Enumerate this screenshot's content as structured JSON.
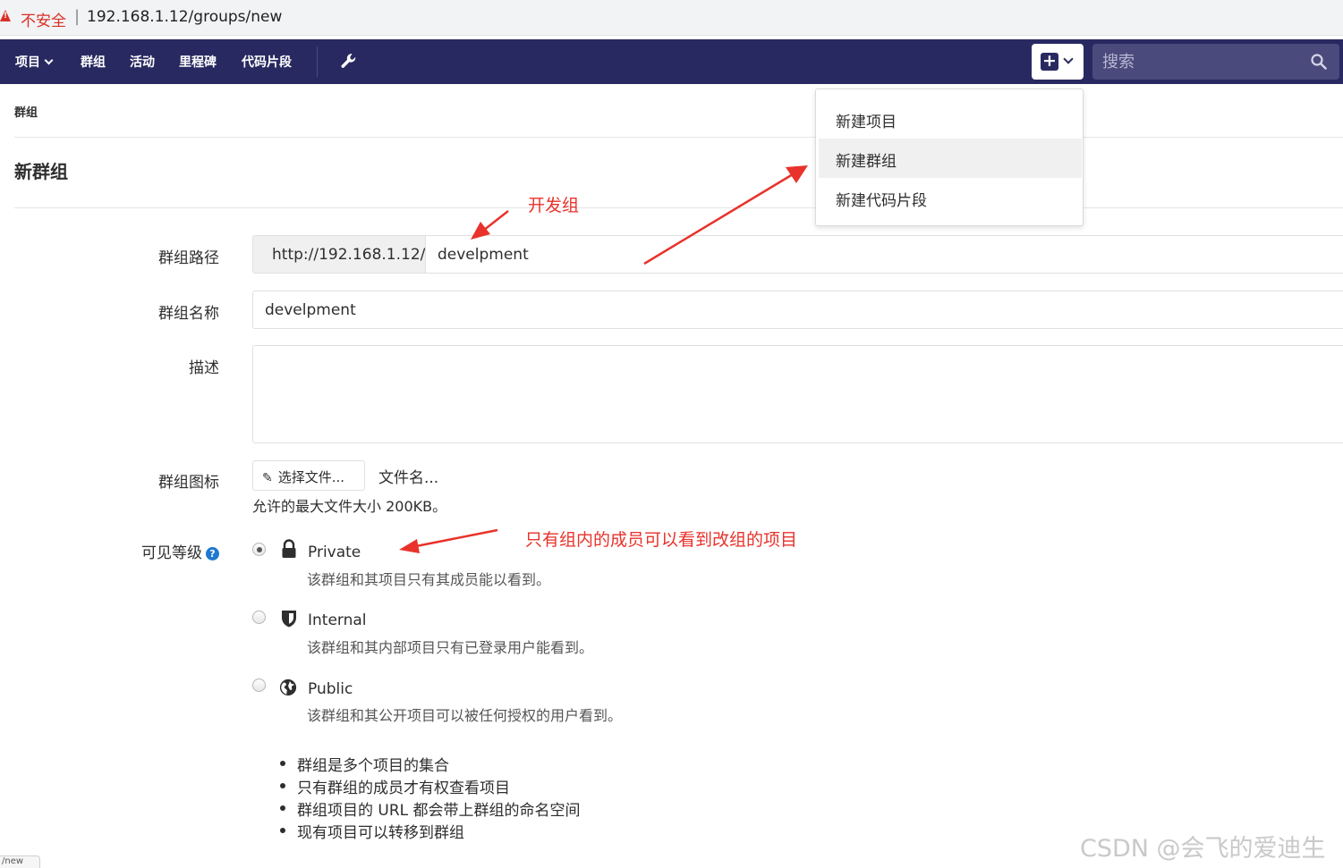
{
  "browser": {
    "insecure_label": "不安全",
    "separator": "|",
    "url": "192.168.1.12/groups/new"
  },
  "nav": {
    "items": [
      {
        "label": "项目"
      },
      {
        "label": "群组"
      },
      {
        "label": "活动"
      },
      {
        "label": "里程碑"
      },
      {
        "label": "代码片段"
      }
    ],
    "search_placeholder": "搜索",
    "color": "#292961"
  },
  "dropdown": {
    "items": [
      {
        "label": "新建项目"
      },
      {
        "label": "新建群组"
      },
      {
        "label": "新建代码片段"
      }
    ],
    "active_index": 1
  },
  "breadcrumb": "群组",
  "page_title": "新群组",
  "form": {
    "path_label": "群组路径",
    "path_prefix": "http://192.168.1.12/",
    "path_value": "develpment",
    "name_label": "群组名称",
    "name_value": "develpment",
    "desc_label": "描述",
    "desc_value": "",
    "icon_label": "群组图标",
    "file_button": "选择文件...",
    "file_name": "文件名...",
    "file_help": "允许的最大文件大小 200KB。",
    "visibility_label": "可见等级",
    "visibility": [
      {
        "title": "Private",
        "desc": "该群组和其项目只有其成员能以看到。",
        "checked": true,
        "icon": "lock-icon"
      },
      {
        "title": "Internal",
        "desc": "该群组和其内部项目只有已登录用户能看到。",
        "checked": false,
        "icon": "shield-icon"
      },
      {
        "title": "Public",
        "desc": "该群组和其公开项目可以被任何授权的用户看到。",
        "checked": false,
        "icon": "globe-icon"
      }
    ]
  },
  "notes": [
    "群组是多个项目的集合",
    "只有群组的成员才有权查看项目",
    "群组项目的 URL 都会带上群组的命名空间",
    "现有项目可以转移到群组"
  ],
  "annotations": {
    "group_note": "开发组",
    "private_note": "只有组内的成员可以看到改组的项目",
    "color": "#e8322b"
  },
  "watermark": "CSDN @会飞的爱迪生",
  "status_tab": "/new"
}
